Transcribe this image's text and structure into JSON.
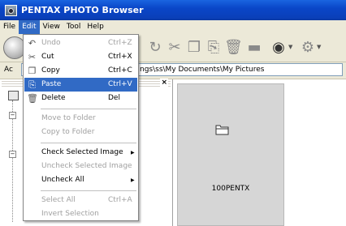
{
  "window": {
    "title": "PENTAX PHOTO Browser"
  },
  "menubar": {
    "items": [
      "File",
      "Edit",
      "View",
      "Tool",
      "Help"
    ]
  },
  "address": {
    "label": "Ac",
    "path": "ngs\\ss\\My Documents\\My Pictures"
  },
  "edit_menu": {
    "undo": {
      "label": "Undo",
      "shortcut": "Ctrl+Z"
    },
    "cut": {
      "label": "Cut",
      "shortcut": "Ctrl+X"
    },
    "copy": {
      "label": "Copy",
      "shortcut": "Ctrl+C"
    },
    "paste": {
      "label": "Paste",
      "shortcut": "Ctrl+V"
    },
    "delete": {
      "label": "Delete",
      "shortcut": "Del"
    },
    "move_to_folder": "Move to Folder",
    "copy_to_folder": "Copy to Folder",
    "check_selected_image": "Check Selected Image",
    "uncheck_selected_image": "Uncheck Selected Image",
    "uncheck_all": "Uncheck All",
    "select_all": {
      "label": "Select All",
      "shortcut": "Ctrl+A"
    },
    "invert_selection": "Invert Selection"
  },
  "browser": {
    "folder_name": "100PENTX"
  },
  "colors": {
    "title_blue": "#0a46c8",
    "highlight": "#316ac5",
    "disabled": "#a0a0a0"
  }
}
